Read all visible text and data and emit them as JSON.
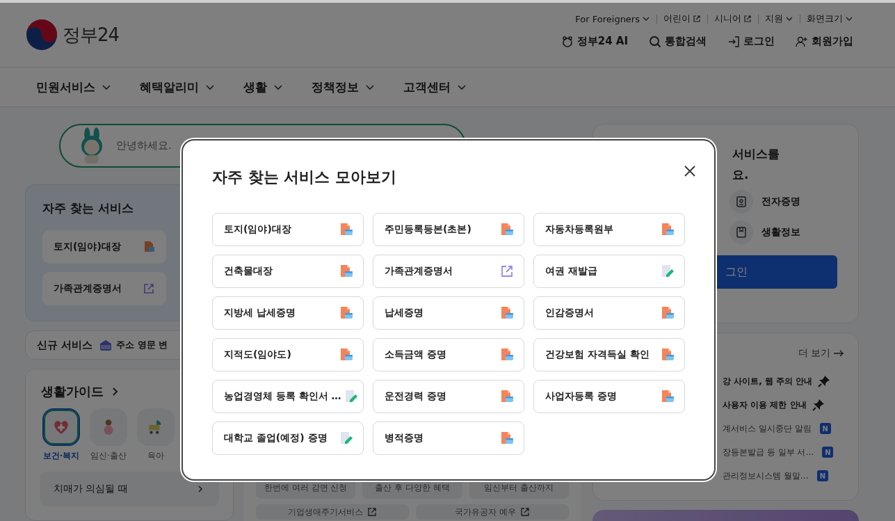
{
  "header": {
    "logo_text": "정부24",
    "utility_links": [
      {
        "label": "For Foreigners",
        "kind": "dropdown"
      },
      {
        "label": "어린이",
        "kind": "external"
      },
      {
        "label": "시니어",
        "kind": "external"
      },
      {
        "label": "지원",
        "kind": "dropdown"
      },
      {
        "label": "화면크기",
        "kind": "dropdown"
      }
    ],
    "actions": [
      {
        "label": "정부24 AI",
        "kind": "ai"
      },
      {
        "label": "통합검색",
        "kind": "search"
      },
      {
        "label": "로그인",
        "kind": "login"
      },
      {
        "label": "회원가입",
        "kind": "signup"
      }
    ]
  },
  "nav": [
    "민원서비스",
    "혜택알리미",
    "생활",
    "정책정보",
    "고객센터"
  ],
  "search": {
    "placeholder": "안녕하세요."
  },
  "frequent_services": {
    "title": "자주 찾는 서비스",
    "items": [
      {
        "label": "토지(임야)대장",
        "kind": "pdf"
      },
      {
        "label": "가족관계증명서",
        "kind": "link"
      }
    ]
  },
  "new_services": {
    "title": "신규 서비스",
    "item": "주소 영문 변"
  },
  "life_guide": {
    "title": "생활가이드",
    "categories": [
      {
        "label": "보건·복지",
        "kind": "health",
        "selected": true
      },
      {
        "label": "임신·출산",
        "kind": "pregnancy",
        "selected": false
      },
      {
        "label": "육아",
        "kind": "childcare",
        "selected": false
      }
    ],
    "topics": [
      "치매가 의심될 때"
    ]
  },
  "guide_tags": [
    {
      "label": "한번에 여러 감면 신청",
      "kind": "plain"
    },
    {
      "label": "출산 후 다양한 혜택",
      "kind": "plain"
    },
    {
      "label": "임신부터 출산까지",
      "kind": "plain"
    },
    {
      "label": "기업생애주기서비스",
      "kind": "external"
    },
    {
      "label": "국가유공자 예우",
      "kind": "external"
    }
  ],
  "user_panel": {
    "greeting_lines": [
      "서비스를",
      "요."
    ],
    "shortcuts": [
      {
        "label": "전자증명",
        "kind": "id"
      },
      {
        "label": "생활정보",
        "kind": "book"
      }
    ],
    "login_button": "그인"
  },
  "notices": {
    "more": "더 보기",
    "items": [
      {
        "title": "강 사이트, 웹 주의 안내",
        "pinned": true
      },
      {
        "title": "사용자 이용 제한 안내",
        "pinned": true
      },
      {
        "title": "계서비스 일시중단 알림",
        "pinned": false,
        "badge": "N"
      },
      {
        "title": "장등본발급 등 일부 서…",
        "pinned": false,
        "badge": "N"
      },
      {
        "title": "관리정보시스템 월말…",
        "pinned": false,
        "badge": "N"
      }
    ]
  },
  "modal": {
    "title": "자주 찾는 서비스 모아보기",
    "items": [
      {
        "label": "토지(임야)대장",
        "kind": "pdf"
      },
      {
        "label": "주민등록등본(초본)",
        "kind": "pdf"
      },
      {
        "label": "자동차등록원부",
        "kind": "pdf"
      },
      {
        "label": "건축물대장",
        "kind": "pdf"
      },
      {
        "label": "가족관계증명서",
        "kind": "link"
      },
      {
        "label": "여권 재발급",
        "kind": "edit"
      },
      {
        "label": "지방세 납세증명",
        "kind": "pdf"
      },
      {
        "label": "납세증명",
        "kind": "pdf"
      },
      {
        "label": "인감증명서",
        "kind": "pdf"
      },
      {
        "label": "지적도(임야도)",
        "kind": "pdf"
      },
      {
        "label": "소득금액 증명",
        "kind": "pdf"
      },
      {
        "label": "건강보험 자격득실 확인",
        "kind": "pdf"
      },
      {
        "label": "농업경영체 등록 확인서 …",
        "kind": "edit"
      },
      {
        "label": "운전경력 증명",
        "kind": "pdf"
      },
      {
        "label": "사업자등록 증명",
        "kind": "pdf"
      },
      {
        "label": "대학교 졸업(예정) 증명",
        "kind": "edit"
      },
      {
        "label": "병적증명",
        "kind": "pdf"
      }
    ]
  }
}
